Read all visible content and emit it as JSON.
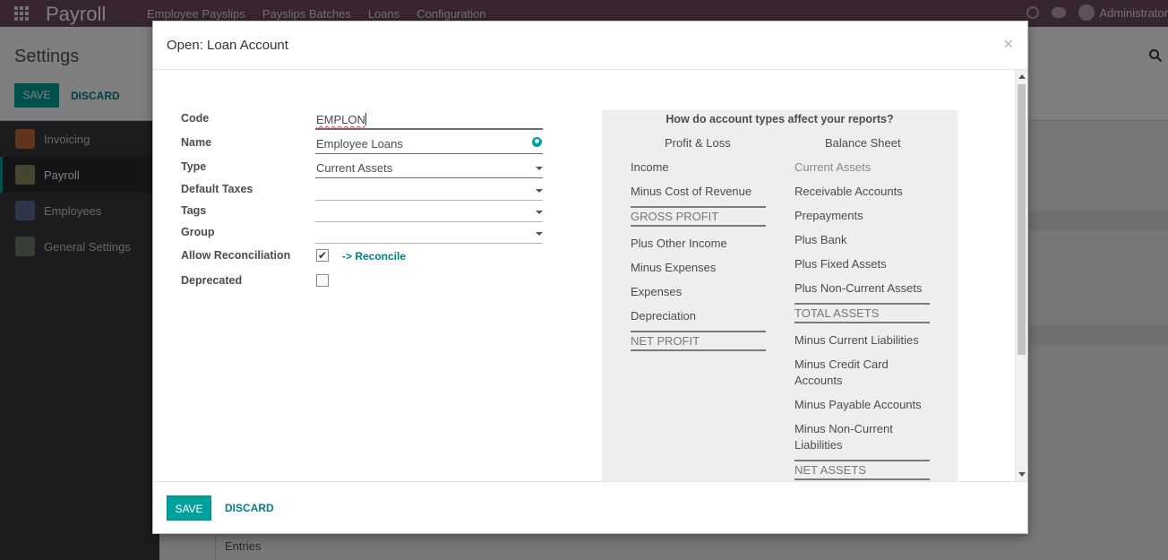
{
  "topbar": {
    "app_name": "Payroll",
    "menu": [
      "Employee Payslips",
      "Payslips Batches",
      "Loans",
      "Configuration"
    ],
    "user": "Administrator"
  },
  "control_panel": {
    "title": "Settings",
    "save_label": "SAVE",
    "discard_label": "DISCARD"
  },
  "sidebar": {
    "items": [
      {
        "label": "Invoicing",
        "icon": "invoicing-icon"
      },
      {
        "label": "Payroll",
        "icon": "payroll-icon"
      },
      {
        "label": "Employees",
        "icon": "employees-icon"
      },
      {
        "label": "General Settings",
        "icon": "gear-icon"
      }
    ]
  },
  "background": {
    "entries_label": "Entries"
  },
  "modal": {
    "title": "Open: Loan Account",
    "close": "×",
    "form": {
      "code_label": "Code",
      "code_value": "EMPLON",
      "name_label": "Name",
      "name_value": "Employee Loans",
      "type_label": "Type",
      "type_value": "Current Assets",
      "taxes_label": "Default Taxes",
      "taxes_value": "",
      "tags_label": "Tags",
      "tags_value": "",
      "group_label": "Group",
      "group_value": "",
      "reconcile_label": "Allow Reconciliation",
      "reconcile_checked": true,
      "reconcile_link": "-> Reconcile",
      "deprecated_label": "Deprecated",
      "deprecated_checked": false
    },
    "report": {
      "title": "How do account types affect your reports?",
      "pl_heading": "Profit & Loss",
      "bs_heading": "Balance Sheet",
      "pl_items": [
        "Income",
        "Minus Cost of Revenue",
        "GROSS PROFIT",
        "Plus Other Income",
        "Minus Expenses",
        "Expenses",
        "Depreciation",
        "NET PROFIT"
      ],
      "bs_items": [
        "Current Assets",
        "Receivable Accounts",
        "Prepayments",
        "Plus Bank",
        "Plus Fixed Assets",
        "Plus Non-Current Assets",
        "TOTAL ASSETS",
        "Minus Current Liabilities",
        "Minus Credit Card Accounts",
        "Minus Payable Accounts",
        "Minus Non-Current Liabilities",
        "NET ASSETS"
      ]
    },
    "footer": {
      "save_label": "SAVE",
      "discard_label": "DISCARD"
    }
  },
  "colors": {
    "topbar": "#6e4a61",
    "primary": "#00a09d",
    "link": "#017e84",
    "sidebar": "#39393f"
  }
}
